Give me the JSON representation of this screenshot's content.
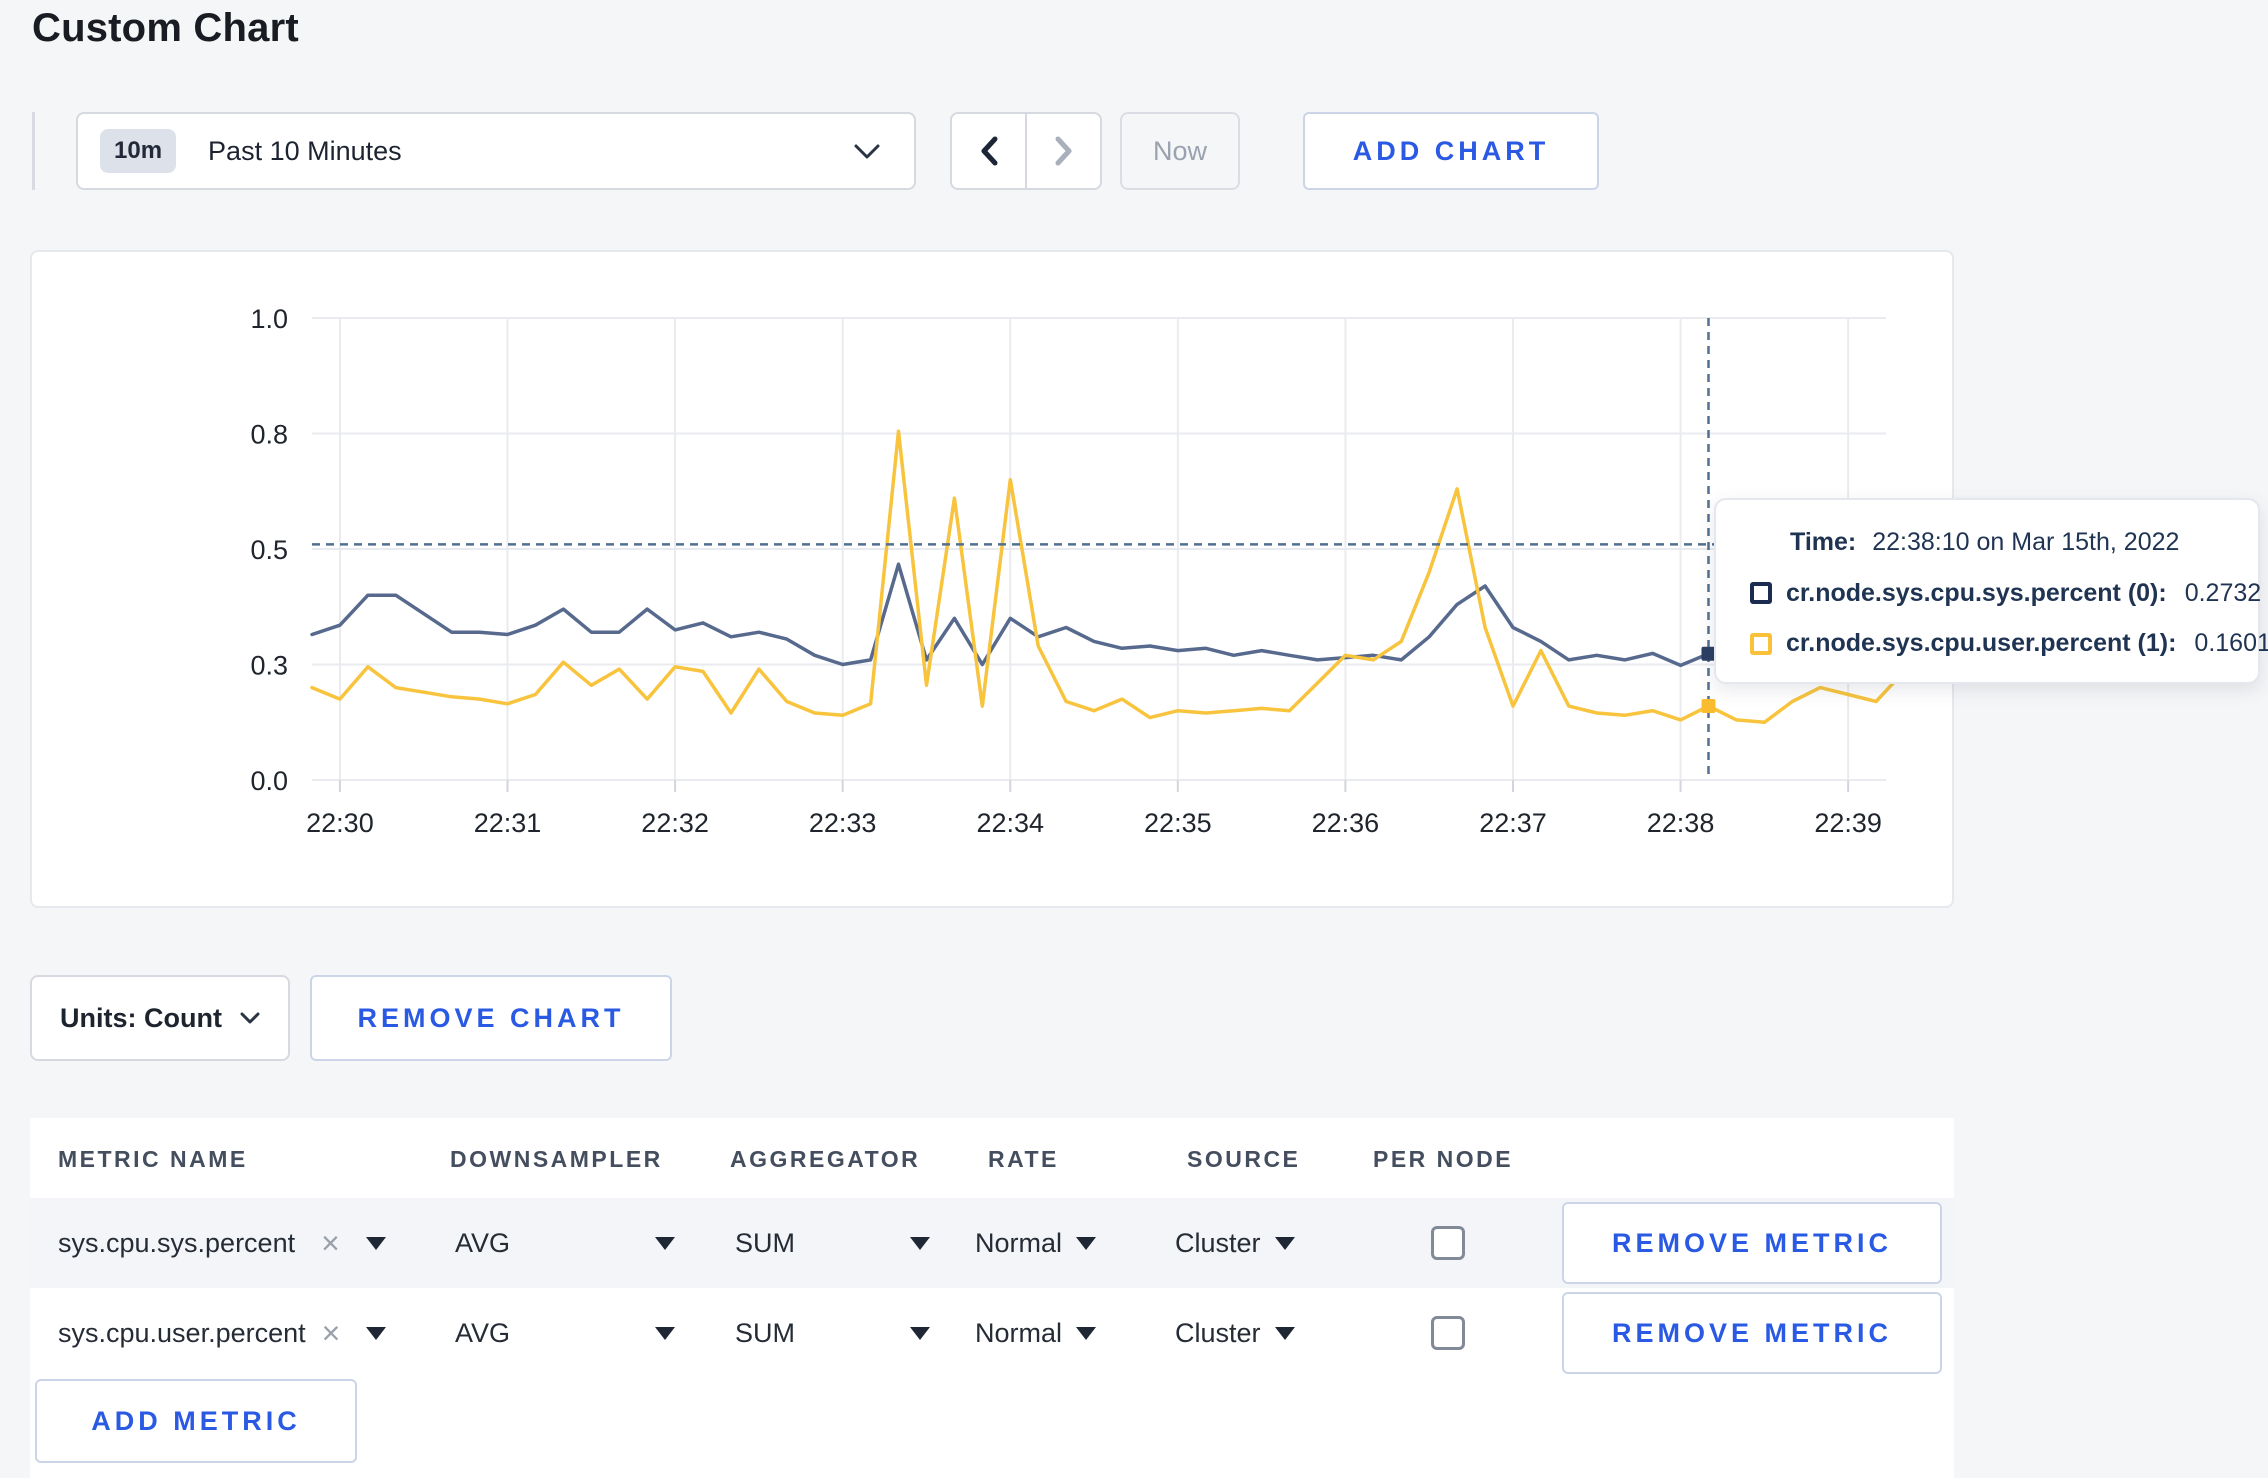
{
  "page": {
    "title": "Custom Chart",
    "background": "#f5f6f8",
    "accent_blue": "#2a5ae3"
  },
  "toolbar": {
    "time_window": {
      "badge": "10m",
      "label": "Past 10 Minutes"
    },
    "now_label": "Now",
    "add_chart_label": "ADD CHART"
  },
  "chart_data": {
    "type": "line",
    "title": "",
    "xlabel": "",
    "ylabel": "",
    "ylim": [
      0,
      1
    ],
    "grid": true,
    "x_labels": [
      "22:30",
      "22:31",
      "22:32",
      "22:33",
      "22:34",
      "22:35",
      "22:36",
      "22:37",
      "22:38",
      "22:39"
    ],
    "y_tick_labels": [
      "0.0",
      "0.3",
      "0.5",
      "0.8",
      "1.0"
    ],
    "y_tick_values": [
      0,
      0.25,
      0.5,
      0.75,
      1.0
    ],
    "start_time": "22:29:50",
    "interval_seconds": 10,
    "series": [
      {
        "name": "cr.node.sys.cpu.sys.percent",
        "color": "#576a8e",
        "point_color": "#2c3e63",
        "values": [
          0.315,
          0.335,
          0.4,
          0.4,
          0.36,
          0.32,
          0.32,
          0.315,
          0.335,
          0.37,
          0.32,
          0.32,
          0.37,
          0.325,
          0.34,
          0.31,
          0.32,
          0.305,
          0.27,
          0.25,
          0.26,
          0.467,
          0.26,
          0.35,
          0.25,
          0.35,
          0.31,
          0.33,
          0.3,
          0.285,
          0.29,
          0.28,
          0.285,
          0.27,
          0.28,
          0.27,
          0.26,
          0.265,
          0.27,
          0.26,
          0.31,
          0.38,
          0.42,
          0.33,
          0.3,
          0.26,
          0.27,
          0.26,
          0.274,
          0.248,
          0.2732,
          0.25,
          0.27,
          0.3,
          0.29,
          0.3,
          0.295,
          0.3
        ]
      },
      {
        "name": "cr.node.sys.cpu.user.percent",
        "color": "#f8c43e",
        "point_color": "#f8bc2e",
        "values": [
          0.2,
          0.175,
          0.245,
          0.2,
          0.19,
          0.18,
          0.175,
          0.165,
          0.185,
          0.255,
          0.205,
          0.24,
          0.175,
          0.245,
          0.235,
          0.145,
          0.24,
          0.17,
          0.145,
          0.14,
          0.165,
          0.755,
          0.205,
          0.61,
          0.16,
          0.65,
          0.29,
          0.17,
          0.15,
          0.175,
          0.135,
          0.15,
          0.145,
          0.15,
          0.155,
          0.15,
          0.21,
          0.27,
          0.26,
          0.3,
          0.45,
          0.63,
          0.33,
          0.16,
          0.28,
          0.16,
          0.145,
          0.14,
          0.15,
          0.13,
          0.1601,
          0.13,
          0.125,
          0.17,
          0.2,
          0.185,
          0.17,
          0.235
        ]
      }
    ],
    "hover": {
      "index": 50,
      "time": "22:38:10",
      "cursor_value": 0.51,
      "values": [
        0.2732,
        0.1601
      ]
    },
    "legend_position": "tooltip"
  },
  "tooltip": {
    "time_label": "Time:",
    "time_value": "22:38:10 on Mar 15th, 2022",
    "entries": [
      {
        "name": "cr.node.sys.cpu.sys.percent (0):",
        "value": "0.2732",
        "color": "#1b2c50"
      },
      {
        "name": "cr.node.sys.cpu.user.percent (1):",
        "value": "0.1601",
        "color": "#fcc13a"
      }
    ]
  },
  "chart_controls": {
    "units_label": "Units: Count",
    "remove_chart_label": "REMOVE CHART"
  },
  "metrics_table": {
    "headers": [
      "METRIC NAME",
      "DOWNSAMPLER",
      "AGGREGATOR",
      "RATE",
      "SOURCE",
      "PER NODE"
    ],
    "rows": [
      {
        "metric": "sys.cpu.sys.percent",
        "downsampler": "AVG",
        "aggregator": "SUM",
        "rate": "Normal",
        "source": "Cluster",
        "per_node": false,
        "remove_label": "REMOVE METRIC"
      },
      {
        "metric": "sys.cpu.user.percent",
        "downsampler": "AVG",
        "aggregator": "SUM",
        "rate": "Normal",
        "source": "Cluster",
        "per_node": false,
        "remove_label": "REMOVE METRIC"
      }
    ],
    "clear_icon": "×",
    "add_metric_label": "ADD METRIC"
  }
}
